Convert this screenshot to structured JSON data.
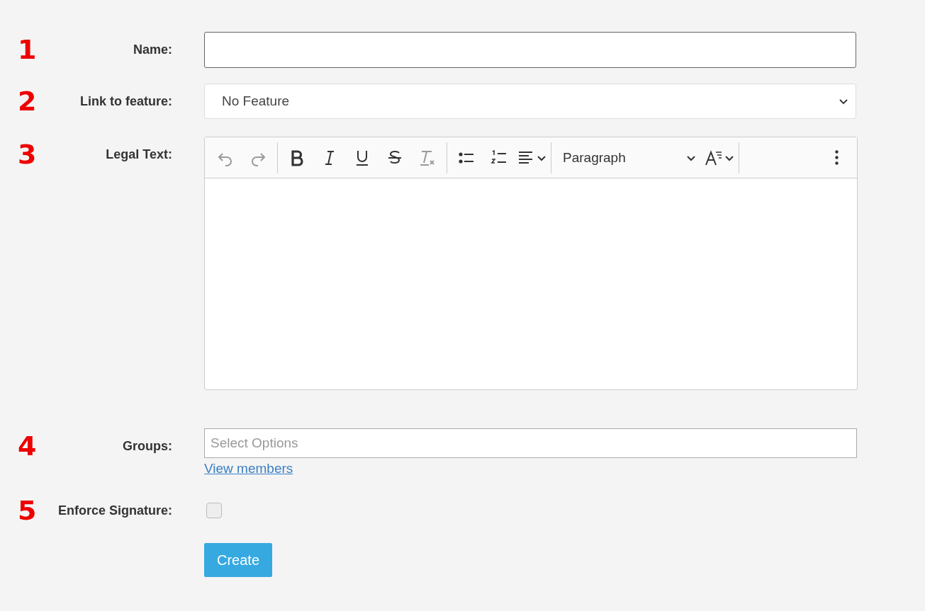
{
  "rows": [
    {
      "number": "1",
      "label": "Name:",
      "kind": "text"
    },
    {
      "number": "2",
      "label": "Link to feature:",
      "kind": "select",
      "value": "No Feature"
    },
    {
      "number": "3",
      "label": "Legal Text:",
      "kind": "editor",
      "toolbar": [
        {
          "kind": "undo",
          "disabled": true
        },
        {
          "kind": "redo",
          "disabled": true
        },
        {
          "kind": "divider"
        },
        {
          "kind": "bold",
          "disabled": false
        },
        {
          "kind": "italic",
          "disabled": false
        },
        {
          "kind": "underline",
          "disabled": false
        },
        {
          "kind": "strike",
          "disabled": false
        },
        {
          "kind": "clear",
          "disabled": true
        },
        {
          "kind": "divider"
        },
        {
          "kind": "bullets",
          "disabled": false
        },
        {
          "kind": "numbers",
          "disabled": false
        },
        {
          "kind": "align",
          "disabled": false
        },
        {
          "kind": "divider"
        },
        {
          "kind": "format",
          "label": "Paragraph"
        },
        {
          "kind": "size",
          "disabled": false
        },
        {
          "kind": "divider"
        },
        {
          "kind": "more",
          "disabled": false
        }
      ]
    },
    {
      "number": "4",
      "label": "Groups:",
      "kind": "multiselect",
      "placeholder": "Select Options",
      "link": "View members"
    },
    {
      "number": "5",
      "label": "Enforce Signature:",
      "kind": "checkbox",
      "checked": false
    }
  ],
  "submit": "Create"
}
